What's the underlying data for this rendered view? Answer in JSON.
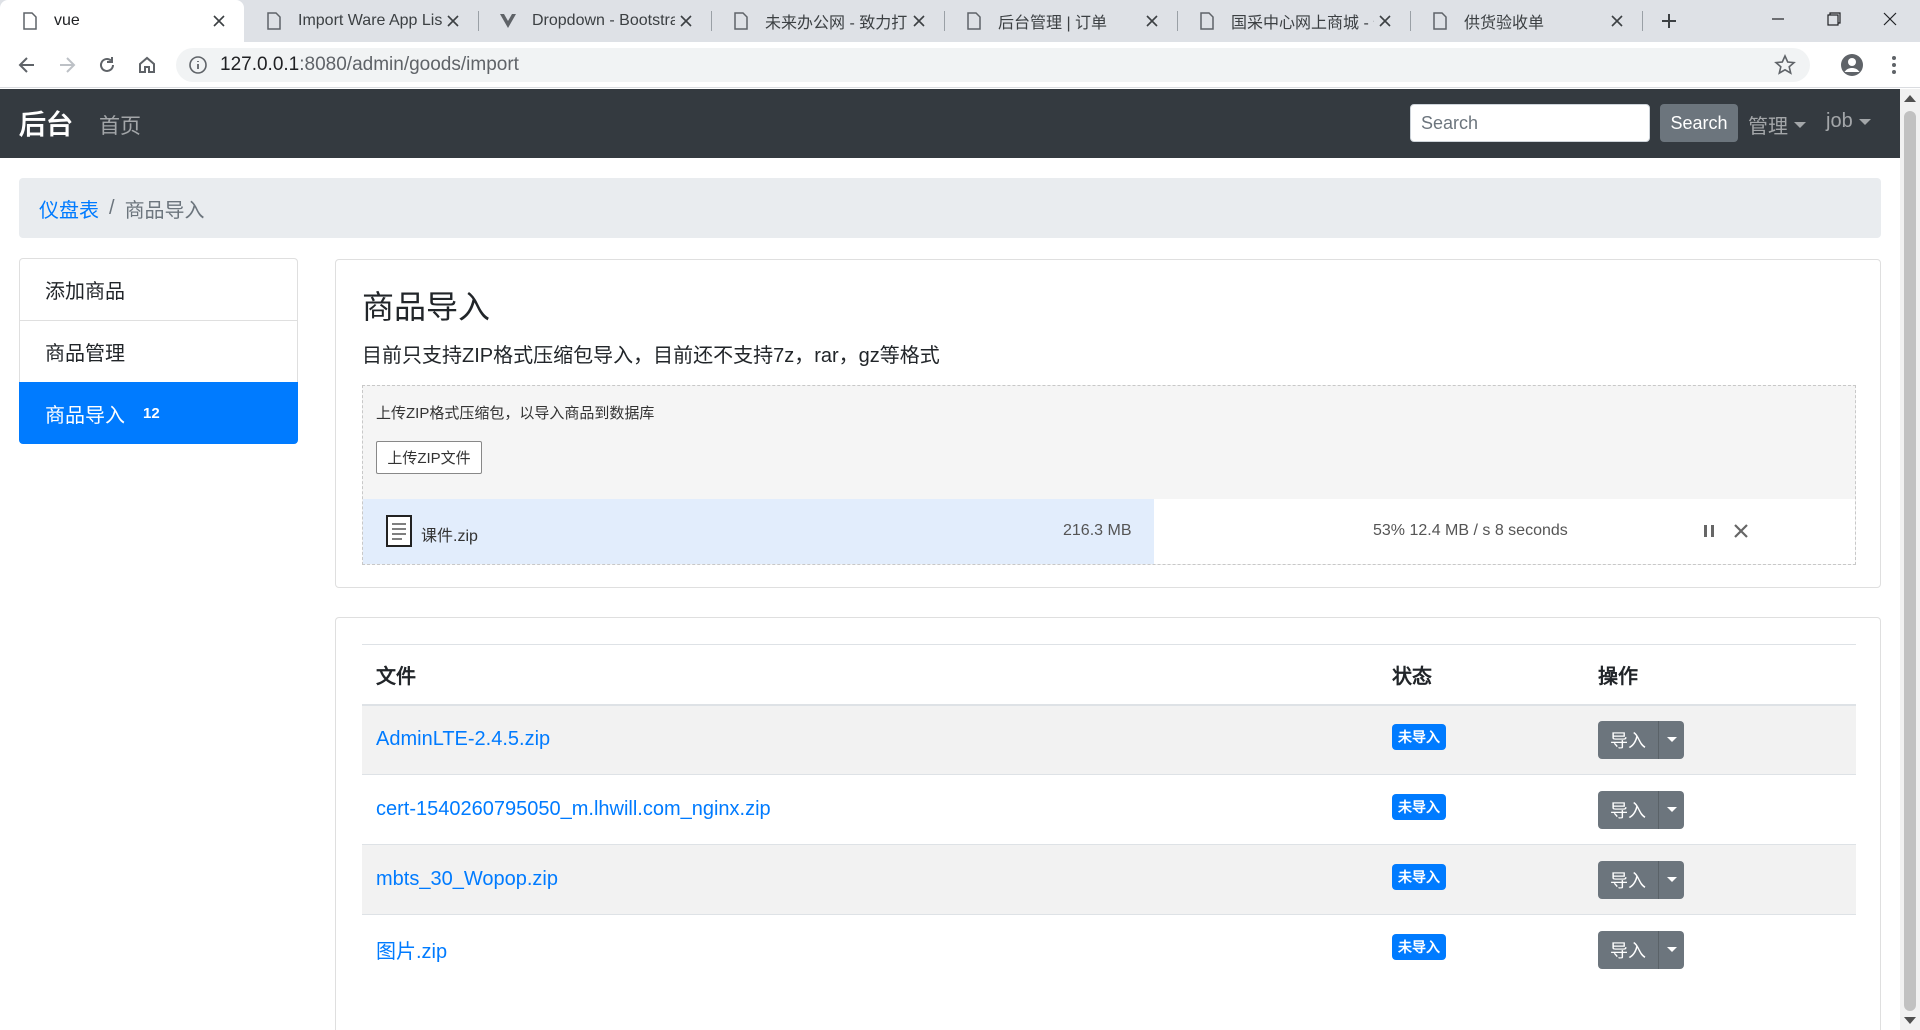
{
  "browser": {
    "tabs": [
      {
        "title": "vue",
        "active": true
      },
      {
        "title": "Import Ware App List"
      },
      {
        "title": "Dropdown - Bootstrap"
      },
      {
        "title": "未来办公网 - 致力打造"
      },
      {
        "title": "后台管理 | 订单"
      },
      {
        "title": "国采中心网上商城 - 供"
      },
      {
        "title": "供货验收单"
      }
    ],
    "url_host": "127.0.0.1",
    "url_rest": ":8080/admin/goods/import"
  },
  "navbar": {
    "brand": "后台",
    "home": "首页",
    "search_placeholder": "Search",
    "search_button": "Search",
    "manage": "管理",
    "user": "job"
  },
  "breadcrumb": {
    "dashboard": "仪盘表",
    "separator": "/",
    "current": "商品导入"
  },
  "sidebar": {
    "items": [
      {
        "label": "添加商品"
      },
      {
        "label": "商品管理"
      },
      {
        "label": "商品导入",
        "badge": "12",
        "active": true
      }
    ]
  },
  "upload": {
    "title": "商品导入",
    "description": "目前只支持ZIP格式压缩包导入，目前还不支持7z，rar，gz等格式",
    "hint": "上传ZIP格式压缩包，以导入商品到数据库",
    "button": "上传ZIP文件",
    "file": {
      "name": "课件.zip",
      "size": "216.3 MB",
      "status": "53% 12.4 MB / s 8 seconds",
      "progress": 0.53
    }
  },
  "table": {
    "headers": {
      "file": "文件",
      "status": "状态",
      "action": "操作"
    },
    "rows": [
      {
        "file": "AdminLTE-2.4.5.zip",
        "status": "未导入",
        "action": "导入"
      },
      {
        "file": "cert-1540260795050_m.lhwill.com_nginx.zip",
        "status": "未导入",
        "action": "导入"
      },
      {
        "file": "mbts_30_Wopop.zip",
        "status": "未导入",
        "action": "导入"
      },
      {
        "file": "图片.zip",
        "status": "未导入",
        "action": "导入"
      }
    ]
  },
  "colors": {
    "primary": "#007bff",
    "navbar": "#343a40",
    "secondary": "#6c757d",
    "progress": "#e2edfc"
  }
}
